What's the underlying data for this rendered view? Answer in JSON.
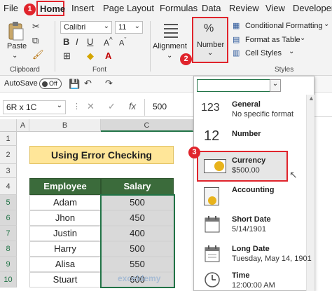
{
  "menu": {
    "tabs": [
      "File",
      "Home",
      "Insert",
      "Page Layout",
      "Formulas",
      "Data",
      "Review",
      "View",
      "Developer"
    ]
  },
  "ribbon": {
    "paste_label": "Paste",
    "clipboard_label": "Clipboard",
    "font_name": "Calibri",
    "font_size": "11",
    "font_group_label": "Font",
    "alignment_label": "Alignment",
    "number_label": "Number",
    "conditional_formatting": "Conditional Formatting",
    "format_as_table": "Format as Table",
    "cell_styles": "Cell Styles",
    "styles_label": "Styles"
  },
  "qat": {
    "autosave_label": "AutoSave",
    "autosave_state": "Off"
  },
  "formula_bar": {
    "name_box": "6R x 1C",
    "fx_label": "fx",
    "value": "500"
  },
  "sheet": {
    "columns": [
      "A",
      "B",
      "C"
    ],
    "rows": [
      "1",
      "2",
      "3",
      "4",
      "5",
      "6",
      "7",
      "8",
      "9",
      "10"
    ],
    "title": "Using Error Checking",
    "headers": [
      "Employee",
      "Salary"
    ],
    "data": [
      [
        "Adam",
        "500"
      ],
      [
        "Jhon",
        "450"
      ],
      [
        "Justin",
        "400"
      ],
      [
        "Harry",
        "500"
      ],
      [
        "Alisa",
        "550"
      ],
      [
        "Stuart",
        "600"
      ]
    ]
  },
  "number_format_menu": {
    "items": [
      {
        "title": "General",
        "sub": "No specific format",
        "icon": "general-123-icon"
      },
      {
        "title": "Number",
        "sub": "",
        "icon": "number-12-icon"
      },
      {
        "title": "Currency",
        "sub": "$500.00",
        "icon": "currency-icon"
      },
      {
        "title": "Accounting",
        "sub": "",
        "icon": "accounting-icon"
      },
      {
        "title": "Short Date",
        "sub": "5/14/1901",
        "icon": "calendar-icon"
      },
      {
        "title": "Long Date",
        "sub": "Tuesday, May 14, 1901",
        "icon": "calendar-icon"
      },
      {
        "title": "Time",
        "sub": "12:00:00 AM",
        "icon": "clock-icon"
      }
    ],
    "number_icon_text": "12",
    "general_icon_text": "123"
  },
  "step_badges": [
    "1",
    "2",
    "3"
  ],
  "watermark": "exceldemy",
  "colors": {
    "highlight": "#e0242c",
    "header_green": "#3b6b3b",
    "title_fill": "#ffe699",
    "selection_grey": "#d9d9d9"
  }
}
